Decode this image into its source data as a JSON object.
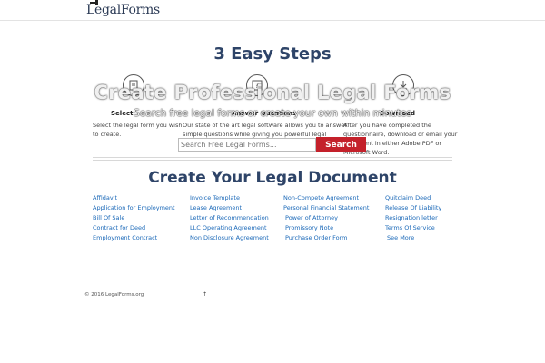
{
  "header": {
    "logo": "LegalForms"
  },
  "steps": {
    "title": "3 Easy Steps",
    "items": [
      {
        "name": "Select",
        "desc_line1": "Select the legal form you wish",
        "desc_line2": "to create."
      },
      {
        "name": "Answer Questions",
        "desc_line1": "Our state of the art legal software allows you to answer",
        "desc_line2": "simple questions while giving you powerful legal"
      },
      {
        "name": "Download",
        "desc_line1": "After you have completed the",
        "desc_line2": "questionnaire, download or email your",
        "desc_line3": "document in either Adobe PDF or",
        "desc_line4": "Microsoft Word."
      }
    ]
  },
  "hero": {
    "title": "Create Professional Legal Forms",
    "subtitle": "Search free legal forms or create your own within minutes"
  },
  "search": {
    "placeholder": "Search Free Legal Forms...",
    "button": "Search"
  },
  "documents": {
    "title": "Create Your Legal Document",
    "col1": [
      "Affidavit",
      "Application for Employment",
      "Bill Of Sale",
      "Contract for Deed",
      "Employment Contract"
    ],
    "col2": [
      "Invoice Template",
      "Lease Agreement",
      "Letter of Recommendation",
      "LLC Operating Agreement",
      "Non Disclosure Agreement"
    ],
    "col3": [
      "Non-Compete Agreement",
      "Personal Financial Statement",
      "Power of Attorney",
      "Promissory Note",
      "Purchase Order Form"
    ],
    "col4": [
      "Quitclaim Deed",
      "Release Of Liability",
      "Resignation letter",
      "Terms Of Service",
      "See More"
    ]
  },
  "footer": {
    "copyright": "© 2016 LegalForms.org",
    "up_arrow": "↑"
  },
  "colors": {
    "heading": "#2e4468",
    "link": "#1a68b8",
    "button": "#c4212b"
  }
}
